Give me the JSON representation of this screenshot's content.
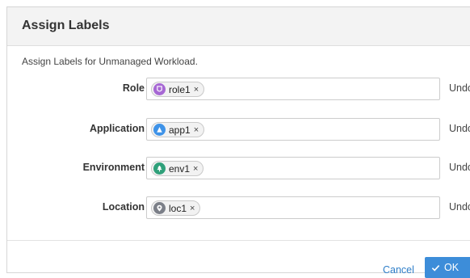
{
  "dialog": {
    "title": "Assign Labels",
    "description": "Assign Labels for Unmanaged Workload."
  },
  "rows": [
    {
      "label": "Role",
      "chip": "role1",
      "chip_color": "#a768d4",
      "icon": "role-icon",
      "undo": "Undo"
    },
    {
      "label": "Application",
      "chip": "app1",
      "chip_color": "#3f93e8",
      "icon": "application-icon",
      "undo": "Undo"
    },
    {
      "label": "Environment",
      "chip": "env1",
      "chip_color": "#2fa07a",
      "icon": "environment-icon",
      "undo": "Undo"
    },
    {
      "label": "Location",
      "chip": "loc1",
      "chip_color": "#7b7f88",
      "icon": "location-icon",
      "undo": "Undo"
    }
  ],
  "chip_remove": "×",
  "footer": {
    "cancel_label": "Cancel",
    "ok_label": "OK"
  }
}
